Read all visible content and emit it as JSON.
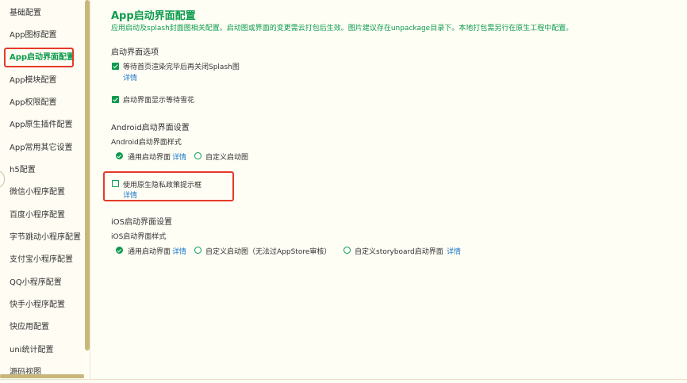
{
  "sidebar": {
    "items": [
      {
        "label": "基础配置"
      },
      {
        "label": "App图标配置"
      },
      {
        "label": "App启动界面配置"
      },
      {
        "label": "App模块配置"
      },
      {
        "label": "App权限配置"
      },
      {
        "label": "App原生插件配置"
      },
      {
        "label": "App常用其它设置"
      },
      {
        "label": "h5配置"
      },
      {
        "label": "微信小程序配置"
      },
      {
        "label": "百度小程序配置"
      },
      {
        "label": "字节跳动小程序配置"
      },
      {
        "label": "支付宝小程序配置"
      },
      {
        "label": "QQ小程序配置"
      },
      {
        "label": "快手小程序配置"
      },
      {
        "label": "快应用配置"
      },
      {
        "label": "uni统计配置"
      },
      {
        "label": "源码视图"
      }
    ],
    "active_item": "App启动界面配置"
  },
  "main": {
    "title": "App启动界面配置",
    "description": "应用启动及splash封面图相关配置。启动图或界面的变更需云打包后生效。图片建议存在unpackage目录下。本地打包需另行在原生工程中配置。",
    "splash_options": {
      "section_title": "启动界面选项",
      "wait_first_page": {
        "label": "等待首页渲染完毕后再关闭Splash图",
        "checked": true,
        "detail": "详情"
      },
      "show_waiting": {
        "label": "启动界面显示等待雪花",
        "checked": true
      }
    },
    "android": {
      "section_title": "Android启动界面设置",
      "style_label": "Android启动界面样式",
      "options": [
        {
          "label": "通用启动界面",
          "selected": true,
          "detail": "详情"
        },
        {
          "label": "自定义启动图",
          "selected": false
        }
      ],
      "privacy_dialog": {
        "label": "使用原生隐私政策提示框",
        "checked": false,
        "detail": "详情"
      }
    },
    "ios": {
      "section_title": "iOS启动界面设置",
      "style_label": "iOS启动界面样式",
      "options": [
        {
          "label": "通用启动界面",
          "selected": true,
          "detail": "详情"
        },
        {
          "label": "自定义启动图（无法过AppStore审核）",
          "selected": false
        },
        {
          "label": "自定义storyboard启动界面",
          "selected": false,
          "detail": "详情"
        }
      ]
    }
  },
  "colors": {
    "accent": "#0b9a4c",
    "link": "#1a76c9",
    "highlight": "#e53a2a",
    "background": "#fffef5"
  }
}
